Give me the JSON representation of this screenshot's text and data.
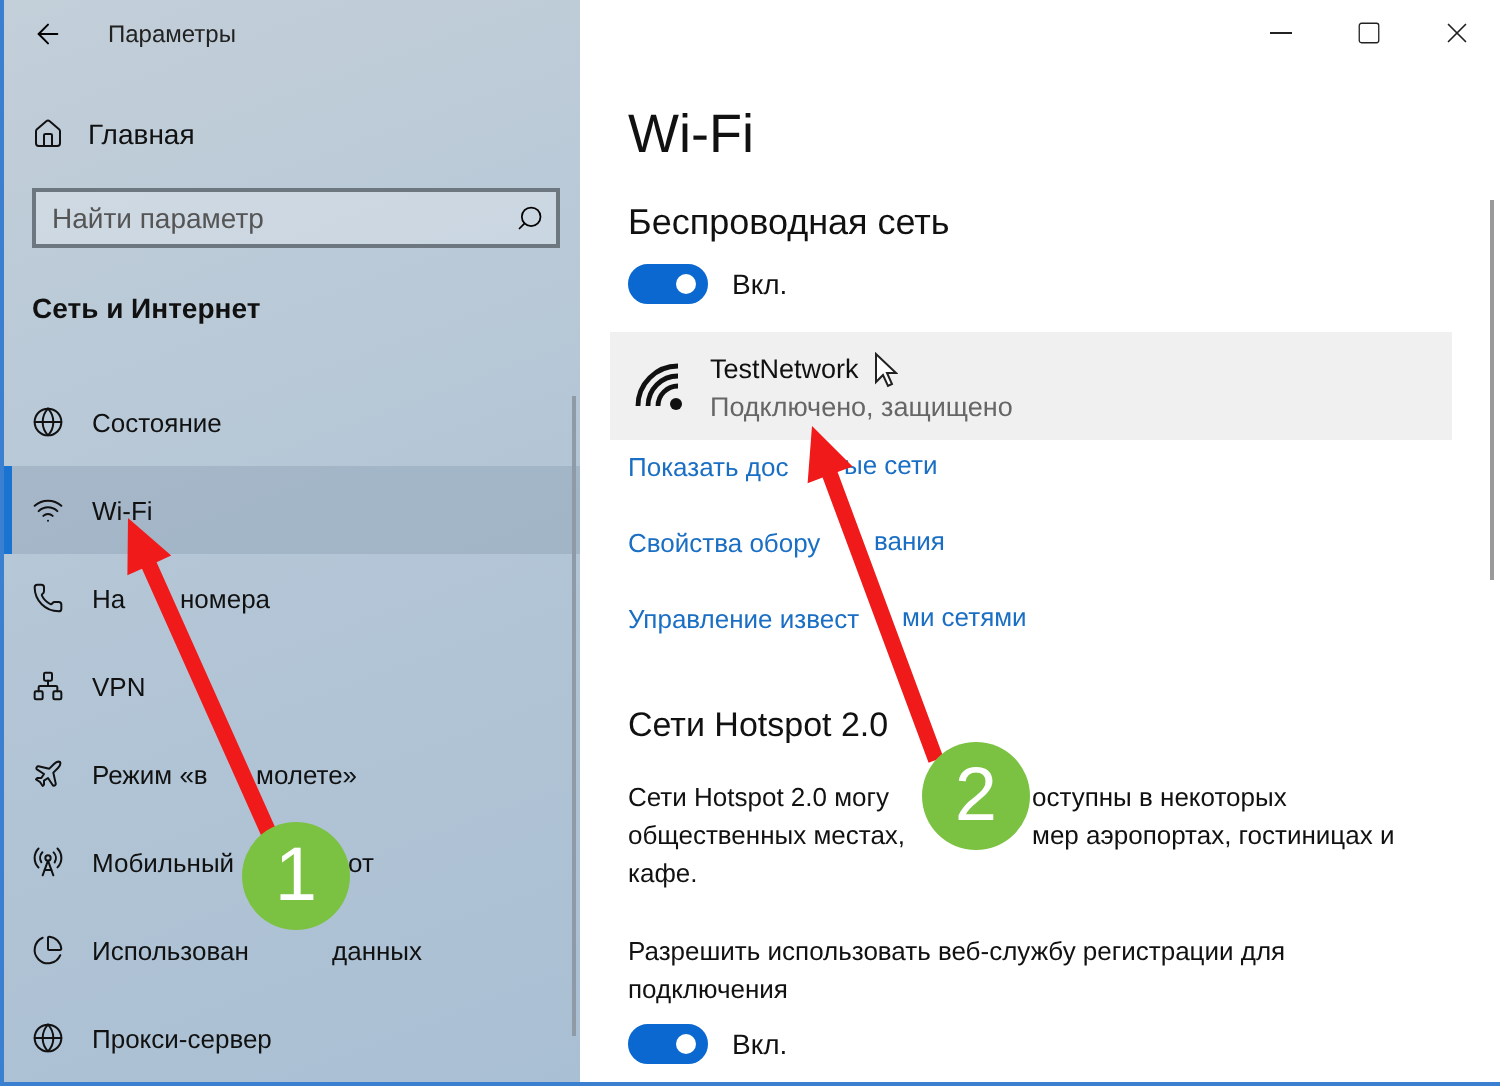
{
  "window": {
    "title": "Параметры"
  },
  "sidebar": {
    "home": "Главная",
    "search": {
      "placeholder": "Найти параметр"
    },
    "section": "Сеть и Интернет",
    "items": [
      {
        "kind": "status",
        "parts": [
          "Состояние"
        ],
        "selected": false
      },
      {
        "kind": "wifi",
        "parts": [
          "Wi-Fi"
        ],
        "selected": true
      },
      {
        "kind": "dialup",
        "parts": [
          "На",
          "номера"
        ],
        "selected": false
      },
      {
        "kind": "vpn",
        "parts": [
          "VPN"
        ],
        "selected": false
      },
      {
        "kind": "airplane",
        "parts": [
          "Режим «в",
          "молете»"
        ],
        "selected": false
      },
      {
        "kind": "hotspot",
        "parts": [
          "Мобильный",
          "от"
        ],
        "selected": false
      },
      {
        "kind": "data",
        "parts": [
          "Использован",
          "данных"
        ],
        "selected": false
      },
      {
        "kind": "proxy",
        "parts": [
          "Прокси-сервер"
        ],
        "selected": false
      }
    ]
  },
  "main": {
    "title": "Wi-Fi",
    "wireless": {
      "heading": "Беспроводная сеть",
      "toggle": {
        "on": true,
        "label": "Вкл."
      }
    },
    "network": {
      "name": "TestNetwork",
      "status": "Подключено, защищено"
    },
    "links": [
      [
        "Показать дос",
        "ые сети"
      ],
      [
        "Свойства обору",
        "вания"
      ],
      [
        "Управление извест",
        "ми сетями"
      ]
    ],
    "hotspot": {
      "heading": "Сети Hotspot 2.0",
      "description_lines": [
        [
          "Сети Hotspot 2.0 могу",
          "оступны в некоторых"
        ],
        [
          "общественных местах,",
          "мер аэропортах, гостиницах и"
        ],
        [
          "кафе."
        ]
      ],
      "setting": "Разрешить использовать веб-службу регистрации для подключения",
      "toggle": {
        "on": true,
        "label": "Вкл."
      }
    }
  },
  "annotations": [
    {
      "label": "1"
    },
    {
      "label": "2"
    }
  ]
}
